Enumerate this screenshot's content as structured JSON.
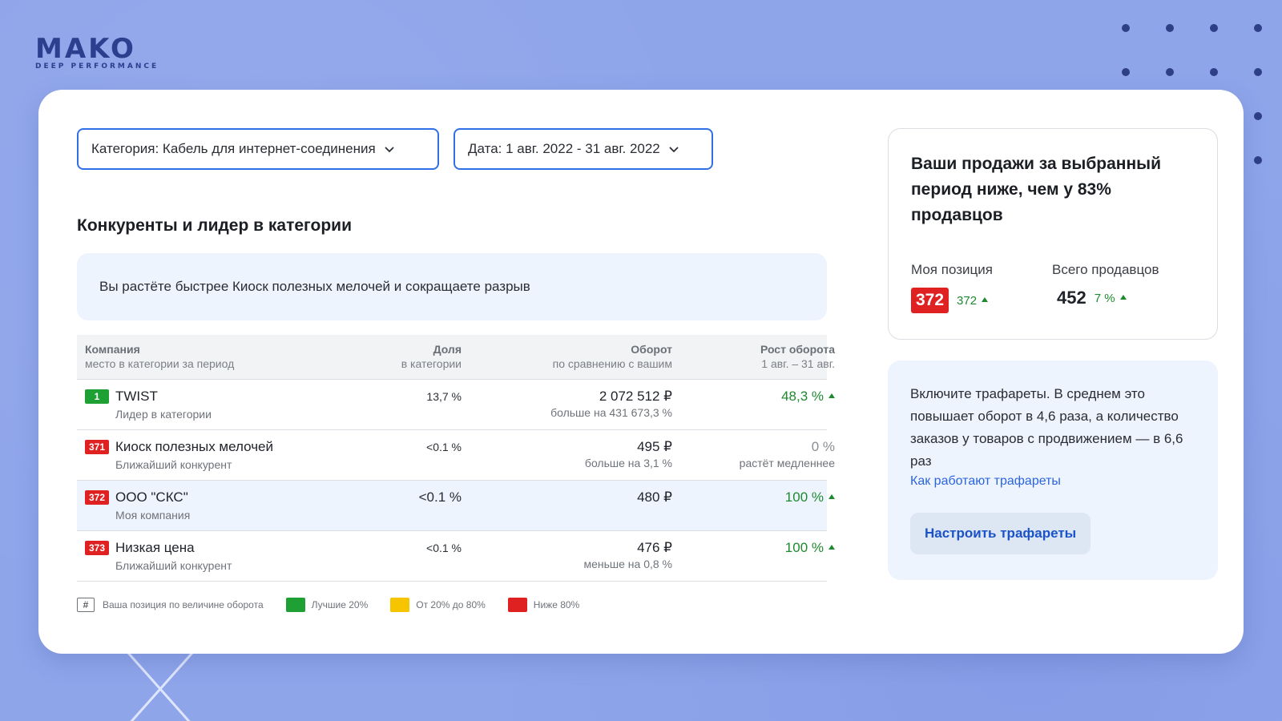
{
  "brand": {
    "name": "MAKO",
    "tagline": "DEEP PERFORMANCE"
  },
  "filters": {
    "category": "Категория: Кабель для интернет-соединения",
    "date": "Дата: 1 авг. 2022 - 31 авг. 2022"
  },
  "section": {
    "title": "Конкуренты и лидер в категории",
    "insight": "Вы растёте быстрее Киоск полезных мелочей и сокращаете разрыв"
  },
  "table": {
    "headers": [
      {
        "main": "Компания",
        "sub": "место в категории за период"
      },
      {
        "main": "Доля",
        "sub": "в категории"
      },
      {
        "main": "Оборот",
        "sub": "по сравнению с вашим"
      },
      {
        "main": "Рост оборота",
        "sub": "1 авг. – 31 авг."
      }
    ],
    "rows": [
      {
        "rank": "1",
        "name": "TWIST",
        "role": "Лидер в категории",
        "share": "13,7 %",
        "turnover": "2 072 512 ₽",
        "turnover_cmp": "больше на 431 673,3 %",
        "growth": "48,3 %",
        "growth_note": ""
      },
      {
        "rank": "371",
        "name": "Киоск полезных мелочей",
        "role": "Ближайший конкурент",
        "share": "<0.1 %",
        "turnover": "495 ₽",
        "turnover_cmp": "больше на 3,1 %",
        "growth": "0 %",
        "growth_note": "растёт медленнее"
      },
      {
        "rank": "372",
        "name": "ООО \"СКС\"",
        "role": "Моя компания",
        "share": "<0.1 %",
        "turnover": "480 ₽",
        "turnover_cmp": "",
        "growth": "100 %",
        "growth_note": ""
      },
      {
        "rank": "373",
        "name": "Низкая цена",
        "role": "Ближайший конкурент",
        "share": "<0.1 %",
        "turnover": "476 ₽",
        "turnover_cmp": "меньше на 0,8 %",
        "growth": "100 %",
        "growth_note": ""
      }
    ]
  },
  "legend": {
    "hash_symbol": "#",
    "hash_label": "Ваша позиция по величине оборота",
    "items": [
      {
        "label": "Лучшие 20%",
        "color": "#1ea034"
      },
      {
        "label": "От 20% до 80%",
        "color": "#f7c400"
      },
      {
        "label": "Ниже 80%",
        "color": "#e02121"
      }
    ]
  },
  "summary": {
    "title": "Ваши продажи за выбранный период ниже, чем у 83% продавцов",
    "position_label": "Моя позиция",
    "position_value": "372",
    "position_delta": "372",
    "total_label": "Всего продавцов",
    "total_value": "452",
    "total_delta": "7 %"
  },
  "promo": {
    "text": "Включите трафареты. В среднем это повышает оборот в 4,6 раза, а количество заказов у товаров с продвижением — в 6,6 раз",
    "link": "Как работают трафареты",
    "button": "Настроить трафареты"
  },
  "colors": {
    "accent": "#2f6fe8",
    "up": "#1e8a2f",
    "danger": "#e02121",
    "background": "#8fa5ea"
  }
}
